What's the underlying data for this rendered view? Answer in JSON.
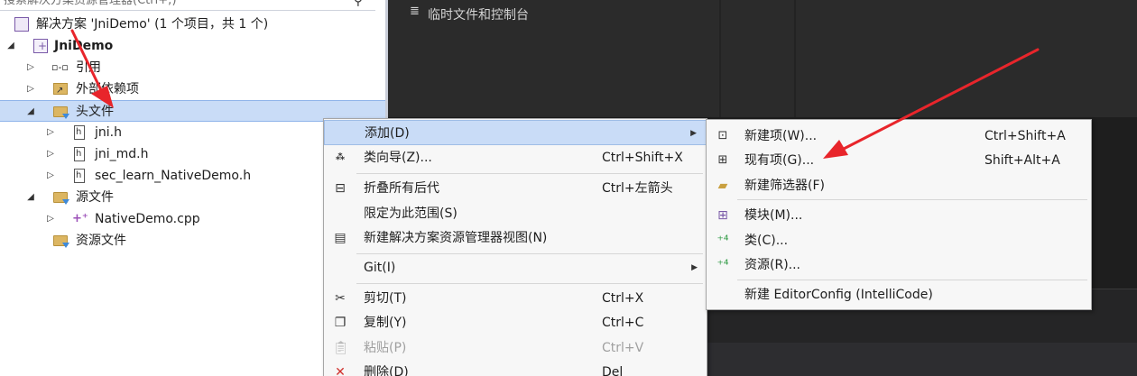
{
  "explorer": {
    "search_placeholder": "搜索解决方案资源管理器(Ctrl+;)",
    "solution_label": "解决方案 'JniDemo' (1 个项目，共 1 个)",
    "project": "JniDemo",
    "items": [
      {
        "label": "引用"
      },
      {
        "label": "外部依赖项"
      },
      {
        "label": "头文件"
      },
      {
        "label": "jni.h"
      },
      {
        "label": "jni_md.h"
      },
      {
        "label": "sec_learn_NativeDemo.h"
      },
      {
        "label": "源文件"
      },
      {
        "label": "NativeDemo.cpp"
      },
      {
        "label": "资源文件"
      }
    ]
  },
  "editor": {
    "tab_label": "临时文件和控制台"
  },
  "context_menu": [
    {
      "label": "添加(D)",
      "key": "",
      "submenu": true
    },
    {
      "label": "类向导(Z)...",
      "key": "Ctrl+Shift+X"
    },
    {
      "label": "折叠所有后代",
      "key": "Ctrl+左箭头"
    },
    {
      "label": "限定为此范围(S)",
      "key": ""
    },
    {
      "label": "新建解决方案资源管理器视图(N)",
      "key": ""
    },
    {
      "label": "Git(I)",
      "key": "",
      "submenu": true
    },
    {
      "label": "剪切(T)",
      "key": "Ctrl+X"
    },
    {
      "label": "复制(Y)",
      "key": "Ctrl+C"
    },
    {
      "label": "粘贴(P)",
      "key": "Ctrl+V",
      "disabled": true
    },
    {
      "label": "删除(D)",
      "key": "Del"
    }
  ],
  "add_submenu": [
    {
      "label": "新建项(W)...",
      "key": "Ctrl+Shift+A"
    },
    {
      "label": "现有项(G)...",
      "key": "Shift+Alt+A"
    },
    {
      "label": "新建筛选器(F)",
      "key": ""
    },
    {
      "label": "模块(M)...",
      "key": ""
    },
    {
      "label": "类(C)...",
      "key": ""
    },
    {
      "label": "资源(R)...",
      "key": ""
    },
    {
      "label": "新建 EditorConfig (IntelliCode)",
      "key": ""
    }
  ],
  "colors": {
    "highlight": "#c9dcf7",
    "annotation_arrow": "#e8252b"
  }
}
